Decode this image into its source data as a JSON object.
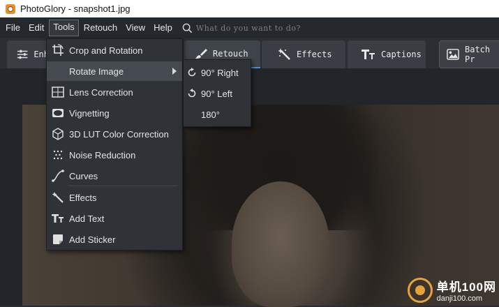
{
  "window": {
    "title": "PhotoGlory - snapshot1.jpg"
  },
  "menubar": {
    "items": [
      "File",
      "Edit",
      "Tools",
      "Retouch",
      "View",
      "Help"
    ],
    "active": "Tools",
    "search_placeholder": "What do you want to do?"
  },
  "toolbar": {
    "tabs": [
      {
        "label": "Enh",
        "icon": "sliders-icon"
      },
      {
        "label": "Retouch",
        "icon": "brush-icon"
      },
      {
        "label": "Effects",
        "icon": "magic-wand-icon"
      },
      {
        "label": "Captions",
        "icon": "text-icon"
      },
      {
        "label": "Batch Pr",
        "icon": "image-icon"
      }
    ],
    "active_tab": "Retouch",
    "accent_color": "#4b8fd6"
  },
  "tools_menu": {
    "items": [
      {
        "label": "Crop and Rotation",
        "icon": "crop-rotate-icon"
      },
      {
        "label": "Rotate Image",
        "icon": "",
        "has_submenu": true
      },
      {
        "label": "Lens Correction",
        "icon": "lens-correction-icon"
      },
      {
        "label": "Vignetting",
        "icon": "vignette-icon"
      },
      {
        "label": "3D LUT Color Correction",
        "icon": "lut-cube-icon"
      },
      {
        "label": "Noise Reduction",
        "icon": "noise-icon"
      },
      {
        "label": "Curves",
        "icon": "curves-icon"
      },
      {
        "label": "Effects",
        "icon": "magic-wand-icon"
      },
      {
        "label": "Add Text",
        "icon": "text-icon"
      },
      {
        "label": "Add Sticker",
        "icon": "sticker-icon"
      }
    ],
    "highlighted": "Rotate Image"
  },
  "rotate_submenu": {
    "items": [
      {
        "label": "90° Right",
        "icon": "rotate-right-icon"
      },
      {
        "label": "90° Left",
        "icon": "rotate-left-icon"
      },
      {
        "label": "180°",
        "icon": ""
      }
    ]
  },
  "watermark": {
    "text_cn": "单机100网",
    "url": "danji100.com"
  }
}
